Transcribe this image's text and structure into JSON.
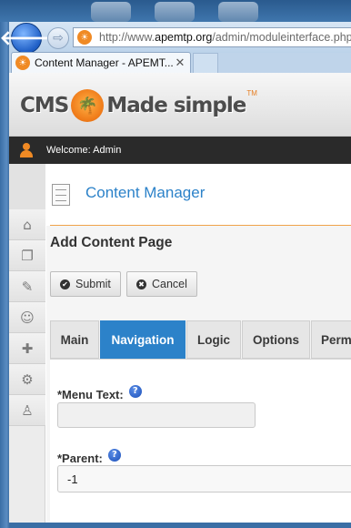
{
  "browser": {
    "address": {
      "prefix": "http://www.",
      "domain": "apemtp.org",
      "path": "/admin/moduleinterface.php"
    },
    "tab": {
      "title": "Content Manager - APEMT...",
      "close": "✕"
    },
    "back_glyph": "🡐",
    "forward_glyph": "⇨"
  },
  "cms": {
    "logo": {
      "left": "CMS",
      "right": "Made simple",
      "tm": "TM"
    },
    "welcome": "Welcome: Admin"
  },
  "sidebar": {
    "items": [
      {
        "icon": "home-icon",
        "glyph": "⌂"
      },
      {
        "icon": "content-pages-icon",
        "glyph": "❐"
      },
      {
        "icon": "layout-icon",
        "glyph": "✎"
      },
      {
        "icon": "users-groups-icon",
        "glyph": "☺"
      },
      {
        "icon": "extensions-icon",
        "glyph": "✚"
      },
      {
        "icon": "site-admin-gear-icon",
        "glyph": "⚙"
      },
      {
        "icon": "my-preferences-icon",
        "glyph": "♙"
      }
    ]
  },
  "page": {
    "title": "Content Manager",
    "section_title": "Add Content Page",
    "buttons": {
      "submit": "Submit",
      "cancel": "Cancel",
      "submit_glyph": "✔",
      "cancel_glyph": "✖"
    },
    "tabs": [
      "Main",
      "Navigation",
      "Logic",
      "Options",
      "Perm"
    ],
    "active_tab": "Navigation",
    "fields": {
      "menu_text": {
        "label": "*Menu Text:",
        "value": ""
      },
      "parent": {
        "label": "*Parent:",
        "value": "-1"
      },
      "help_glyph": "?"
    }
  },
  "colors": {
    "accent": "#2c82c9",
    "brand_orange": "#f08a24"
  }
}
